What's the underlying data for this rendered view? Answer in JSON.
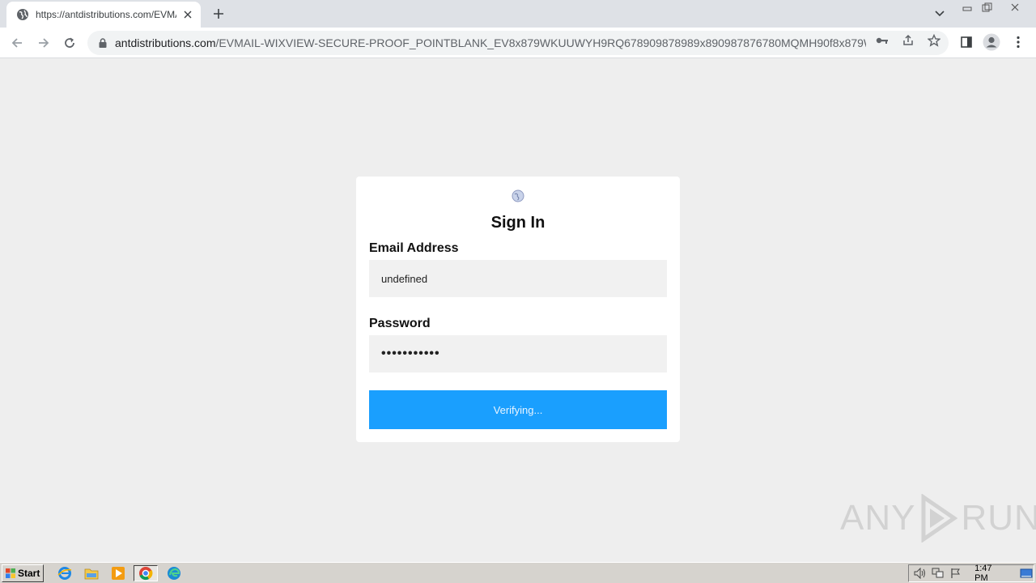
{
  "browser": {
    "tab": {
      "title": "https://antdistributions.com/EVMAIL"
    },
    "address_bar": {
      "host": "antdistributions.com",
      "path": "/EVMAIL-WIXVIEW-SECURE-PROOF_POINTBLANK_EV8x879WKUUWYH9RQ678909878989x890987876780MQMH90f8x879WK..."
    }
  },
  "login": {
    "title": "Sign In",
    "email_label": "Email Address",
    "email_value": "undefined",
    "password_label": "Password",
    "password_value": "•••••••••••",
    "submit_label": "Verifying..."
  },
  "watermark": {
    "left": "ANY",
    "right": "RUN"
  },
  "taskbar": {
    "start_label": "Start",
    "clock": "1:47 PM"
  },
  "colors": {
    "submit_bg": "#1a9ffe",
    "page_bg": "#eeeeee",
    "tabstrip_bg": "#dee1e6"
  }
}
